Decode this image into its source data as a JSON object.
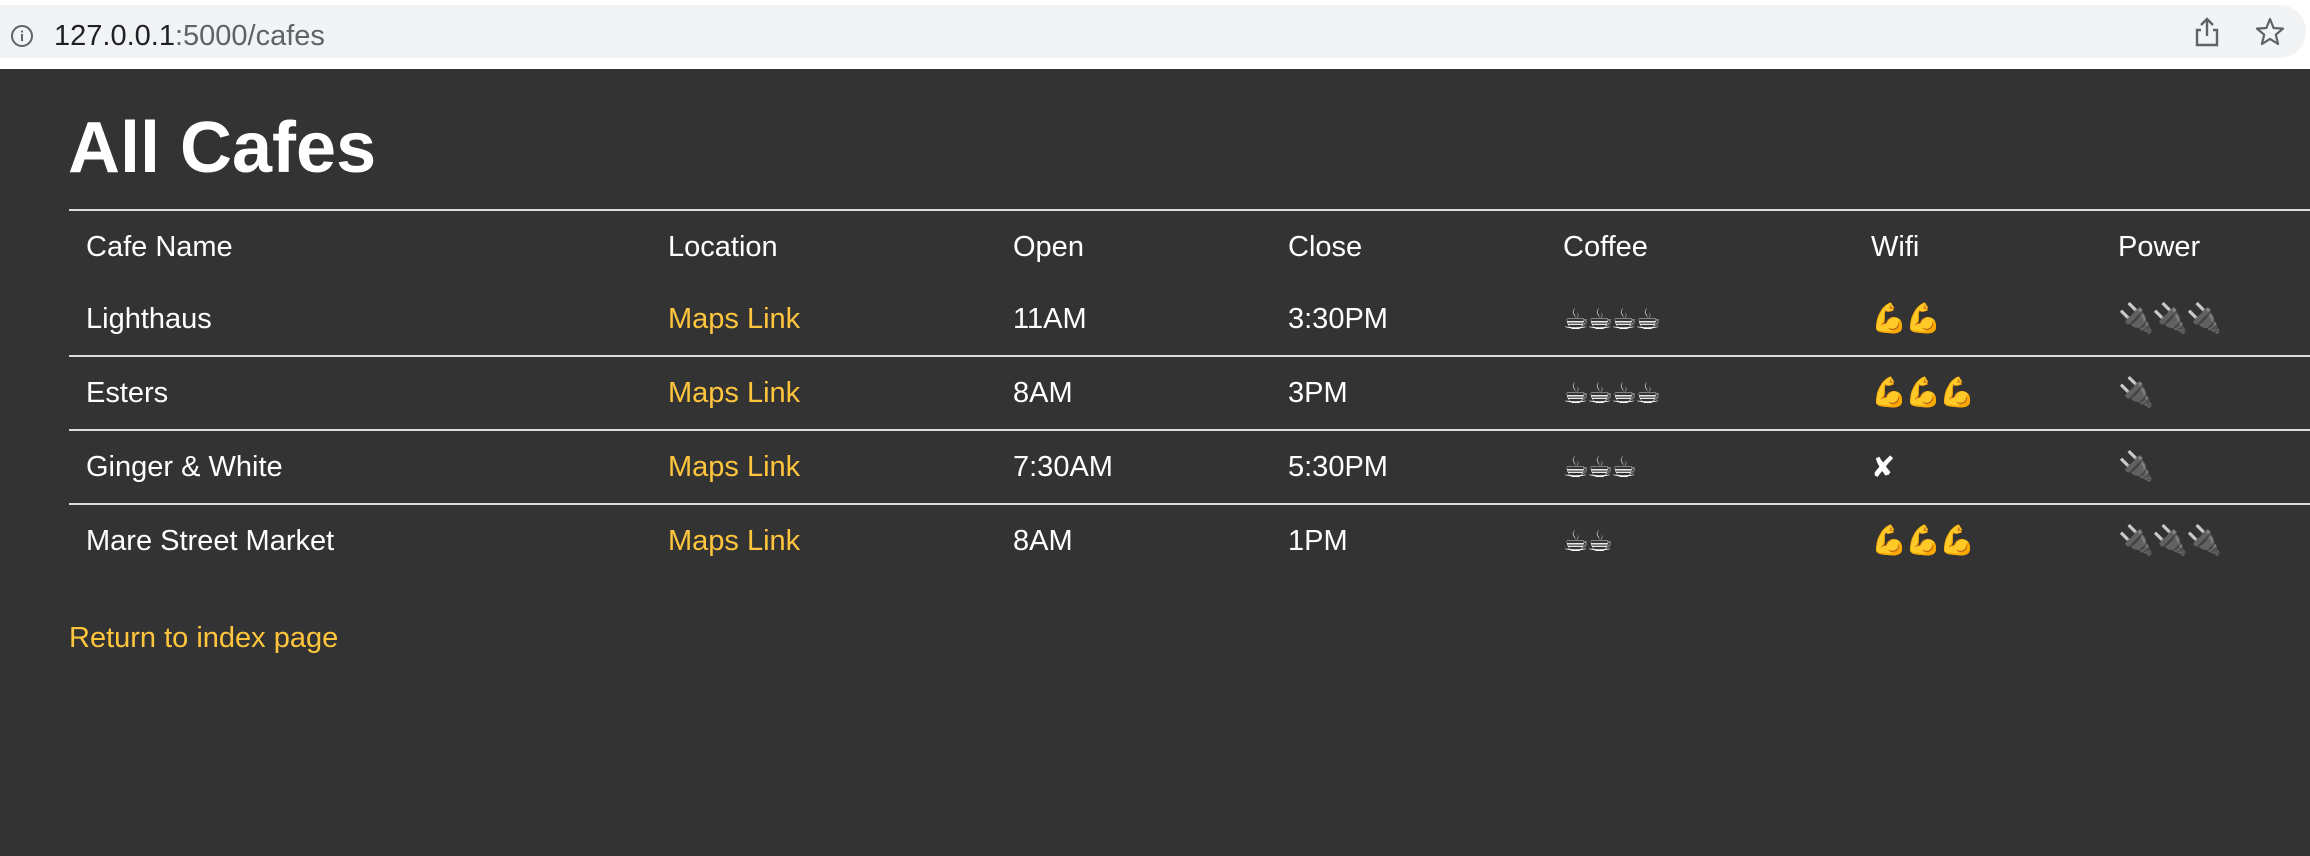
{
  "browser": {
    "url_host": "127.0.0.1",
    "url_rest": ":5000/cafes"
  },
  "page": {
    "title": "All Cafes",
    "return_link": "Return to index page"
  },
  "table": {
    "headers": [
      "Cafe Name",
      "Location",
      "Open",
      "Close",
      "Coffee",
      "Wifi",
      "Power"
    ],
    "rows": [
      {
        "name": "Lighthaus",
        "location": "Maps Link",
        "open": "11AM",
        "close": "3:30PM",
        "coffee": "☕☕☕☕",
        "wifi": "💪💪",
        "power": "🔌🔌🔌"
      },
      {
        "name": "Esters",
        "location": "Maps Link",
        "open": "8AM",
        "close": "3PM",
        "coffee": "☕☕☕☕",
        "wifi": "💪💪💪",
        "power": "🔌"
      },
      {
        "name": "Ginger & White",
        "location": "Maps Link",
        "open": "7:30AM",
        "close": "5:30PM",
        "coffee": "☕☕☕",
        "wifi": "✘",
        "power": "🔌"
      },
      {
        "name": "Mare Street Market",
        "location": "Maps Link",
        "open": "8AM",
        "close": "1PM",
        "coffee": "☕☕",
        "wifi": "💪💪💪",
        "power": "🔌🔌🔌"
      }
    ]
  },
  "icons": {
    "address_bar": "info-icon",
    "toolbar": [
      "share-icon",
      "star-icon"
    ]
  },
  "colors": {
    "background": "#333333",
    "link": "#ffc53d",
    "text": "#ffffff",
    "row_border": "#dddddd"
  }
}
